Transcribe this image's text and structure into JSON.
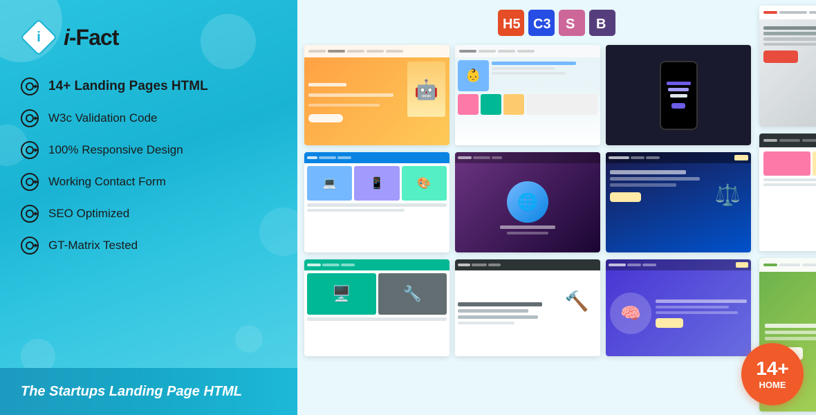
{
  "logo": {
    "name": "i-Fact",
    "prefix": "i",
    "suffix": "-Fact"
  },
  "features": [
    {
      "id": "landing-pages",
      "text": "14+ Landing Pages HTML",
      "bold": true
    },
    {
      "id": "w3c",
      "text": "W3c Validation Code",
      "bold": false
    },
    {
      "id": "responsive",
      "text": "100% Responsive Design",
      "bold": false
    },
    {
      "id": "contact-form",
      "text": "Working Contact Form",
      "bold": false
    },
    {
      "id": "seo",
      "text": "SEO Optimized",
      "bold": false
    },
    {
      "id": "gtmatrix",
      "text": "GT-Matrix Tested",
      "bold": false
    }
  ],
  "bottom_banner": {
    "text": "The Startups Landing Page HTML"
  },
  "badge": {
    "number": "14+",
    "label": "HOME"
  },
  "tech_icons": [
    {
      "id": "html5",
      "label": "5",
      "prefix": "H"
    },
    {
      "id": "css3",
      "label": "3",
      "prefix": "C"
    },
    {
      "id": "sass",
      "label": "S"
    },
    {
      "id": "bootstrap",
      "label": "B"
    }
  ]
}
